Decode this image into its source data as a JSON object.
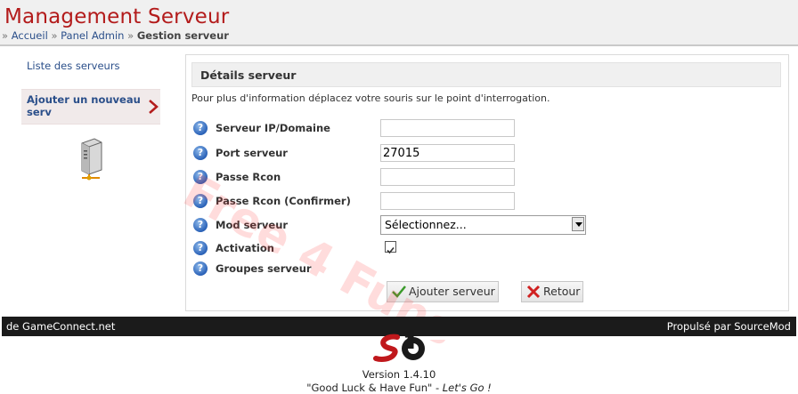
{
  "header": {
    "title": "Management Serveur",
    "breadcrumb": {
      "sep": "»",
      "home": "Accueil",
      "admin": "Panel Admin",
      "current": "Gestion serveur"
    }
  },
  "sidebar": {
    "items": [
      {
        "label": "Liste des serveurs"
      },
      {
        "label": "Ajouter un nouveau serv"
      }
    ],
    "icon": "server-icon"
  },
  "panel": {
    "title": "Détails serveur",
    "info": "Pour plus d'information déplacez votre souris sur le point d'interrogation.",
    "help_icon": "?",
    "fields": [
      {
        "label": "Serveur IP/Domaine",
        "value": ""
      },
      {
        "label": "Port serveur",
        "value": "27015"
      },
      {
        "label": "Passe Rcon",
        "value": ""
      },
      {
        "label": "Passe Rcon (Confirmer)",
        "value": ""
      },
      {
        "label": "Mod serveur",
        "value": "Sélectionnez..."
      },
      {
        "label": "Activation",
        "checked": true
      },
      {
        "label": "Groupes serveur"
      }
    ],
    "buttons": {
      "add": "Ajouter serveur",
      "back": "Retour"
    }
  },
  "watermark": "Free 4 Funs",
  "footer": {
    "left": "de GameConnect.net",
    "right": "Propulsé par SourceMod",
    "version": "Version 1.4.10",
    "tagline_quote": "\"Good Luck & Have Fun\"",
    "tagline_dash": " - ",
    "tagline_em": "Let's Go !"
  },
  "colors": {
    "title_red": "#b31b1b",
    "link_blue": "#2b4f8a",
    "footer_bg": "#1b1b1b",
    "help_blue": "#2a62b8"
  }
}
